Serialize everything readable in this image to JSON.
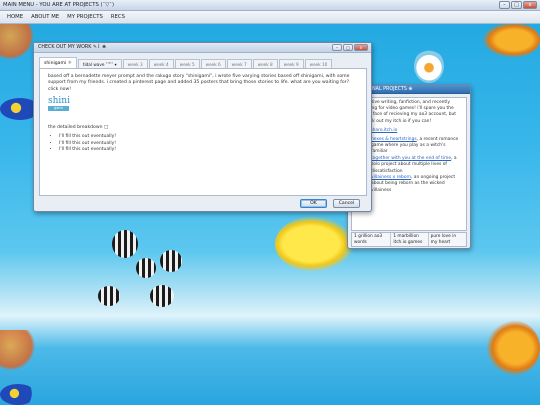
{
  "window": {
    "title": "MAIN MENU - YOU ARE AT PROJECTS (ˉ▽ˉ)",
    "controls": [
      "–",
      "□",
      "x"
    ]
  },
  "nav": {
    "items": [
      "HOME",
      "ABOUT ME",
      "MY PROJECTS",
      "RECS"
    ]
  },
  "dialog": {
    "title": "CHECK OUT MY WORK ✎꒰ ❀",
    "controls": [
      "–",
      "□",
      "x"
    ],
    "tabs": [
      {
        "label": "shinigami ☼"
      },
      {
        "label": "tidal wave ˃꒳˂ ▾"
      },
      {
        "label": "week 3"
      },
      {
        "label": "week 4"
      },
      {
        "label": "week 5"
      },
      {
        "label": "week 6"
      },
      {
        "label": "week 7"
      },
      {
        "label": "week 8"
      },
      {
        "label": "week 9"
      },
      {
        "label": "week 10"
      }
    ],
    "intro": "based off a bernadette meyer prompt and the rakugo story \"shinigami\", i wrote five varying stories based off shinigami, with some support from my friends. i created a pinterest page and added 35 posters that bring those stories to life. what are you waiting for? click now!",
    "logo": {
      "main": "shini",
      "sub": "gami"
    },
    "breakdown_label": "the detailed breakdown □",
    "breakdown_items": [
      "I'll fill this out eventually!",
      "I'll fill this out eventually!",
      "I'll fill this out eventually!"
    ],
    "ok_label": "OK",
    "cancel_label": "Cancel"
  },
  "side_panel": {
    "title": "PERSONAL PROJECTS ❀",
    "intro": "creative writing, fanfiction, and recently writing for video games! i'll spare you the fake face of recieving my ao3 account, but check out my itch.io if you can!",
    "link": "sunpharo.itch.io",
    "projects": [
      {
        "link": "hexes & heartstrings",
        "desc": ", a recent romance game where you play as a witch's familiar"
      },
      {
        "link": "together with you at the end of time",
        "desc": ", a solo project about multiple lives of dissatisfaction"
      },
      {
        "link": "villainess x reborn",
        "desc": ", an ongoing project about being reborn as the wicked villainess"
      }
    ],
    "status": [
      "1 grillion ao3 words",
      "1 marbillion itch.io games",
      "pure love in my heart"
    ]
  }
}
